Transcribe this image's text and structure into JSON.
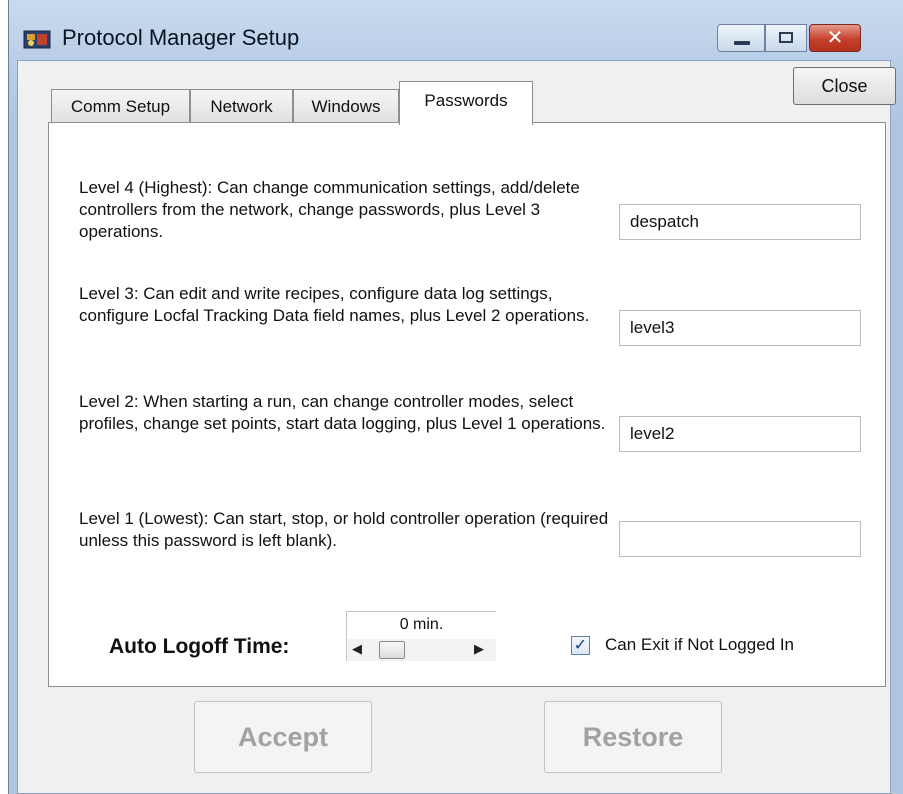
{
  "window": {
    "title": "Protocol Manager Setup",
    "controls": {
      "minimize_icon": "minimize-icon",
      "maximize_icon": "maximize-icon",
      "close_glyph": "✕"
    }
  },
  "close_button": {
    "label": "Close"
  },
  "tabs": [
    {
      "label": "Comm Setup",
      "active": false
    },
    {
      "label": "Network",
      "active": false
    },
    {
      "label": "Windows",
      "active": false
    },
    {
      "label": "Passwords",
      "active": true
    }
  ],
  "levels": [
    {
      "description": "Level 4 (Highest): Can change communication settings, add/delete controllers from the network, change passwords, plus Level 3 operations.",
      "password": "despatch"
    },
    {
      "description": "Level 3: Can edit and write recipes, configure data log settings, configure Locfal Tracking Data field names, plus Level 2 operations.",
      "password": "level3"
    },
    {
      "description": "Level 2: When starting a run, can change controller modes, select profiles, change set points, start data logging, plus Level 1 operations.",
      "password": "level2"
    },
    {
      "description": "Level 1 (Lowest): Can start, stop, or hold controller operation (required unless this password is left blank).",
      "password": ""
    }
  ],
  "auto_logoff": {
    "label": "Auto Logoff Time:",
    "value": "0 min.",
    "slider_fraction": 0.0
  },
  "can_exit": {
    "label": "Can Exit if Not Logged In",
    "checked": true,
    "check_glyph": "✓"
  },
  "buttons": {
    "accept": "Accept",
    "restore": "Restore"
  },
  "colors": {
    "window_frame": "#b7cde6",
    "close_red": "#c5402d",
    "disabled_text": "#a2a2a2"
  }
}
